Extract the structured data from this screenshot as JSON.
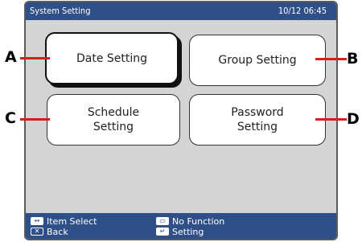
{
  "header": {
    "title": "System Setting",
    "datetime": "10/12 06:45"
  },
  "buttons": [
    {
      "id": "date",
      "label": "Date Setting",
      "selected": true
    },
    {
      "id": "group",
      "label": "Group Setting"
    },
    {
      "id": "schedule",
      "label": "Schedule\nSetting"
    },
    {
      "id": "password",
      "label": "Password\nSetting"
    }
  ],
  "callouts": {
    "a": "A",
    "b": "B",
    "c": "C",
    "d": "D"
  },
  "footer": {
    "item_select": "Item Select",
    "back": "Back",
    "no_function": "No Function",
    "setting": "Setting"
  },
  "icons": {
    "item_select": "left-right-arrows-icon",
    "back": "back-icon",
    "no_function": "screen-icon",
    "setting": "enter-return-icon"
  },
  "colors": {
    "titlebar": "#2f4f88",
    "screen_bg": "#d4d4d4",
    "leader": "#d21f1f"
  }
}
